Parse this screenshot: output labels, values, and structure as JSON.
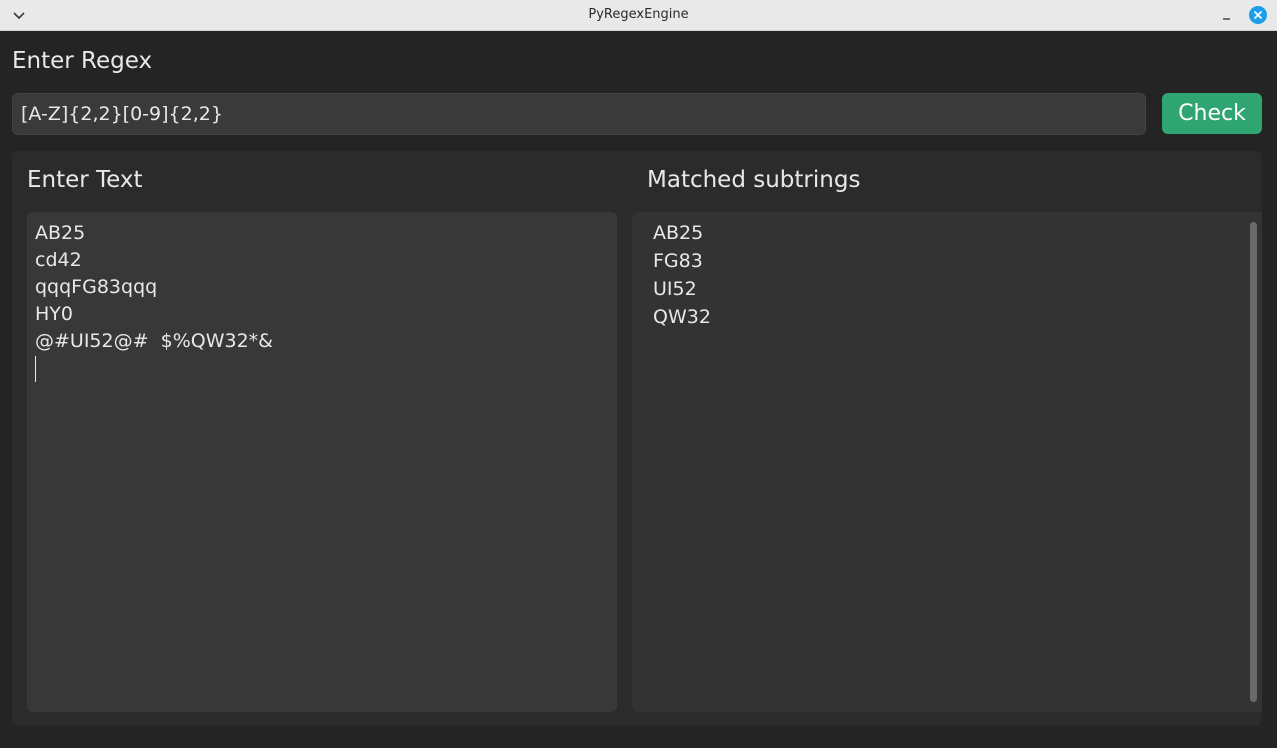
{
  "window": {
    "title": "PyRegexEngine",
    "menu_icon": "chevron-down-icon",
    "minimize_icon": "minimize-icon",
    "close_icon": "close-icon",
    "close_color": "#1a9fe8"
  },
  "regex": {
    "label": "Enter Regex",
    "value": "[A-Z]{2,2}[0-9]{2,2}"
  },
  "check_button": {
    "label": "Check",
    "color": "#2fa572"
  },
  "input_panel": {
    "label": "Enter Text",
    "lines": [
      "AB25",
      "cd42",
      "qqqFG83qqq",
      "HY0",
      "@#UI52@#  $%QW32*&"
    ]
  },
  "results_panel": {
    "label": "Matched subtrings",
    "matches": [
      "AB25",
      "FG83",
      "UI52",
      "QW32"
    ]
  }
}
